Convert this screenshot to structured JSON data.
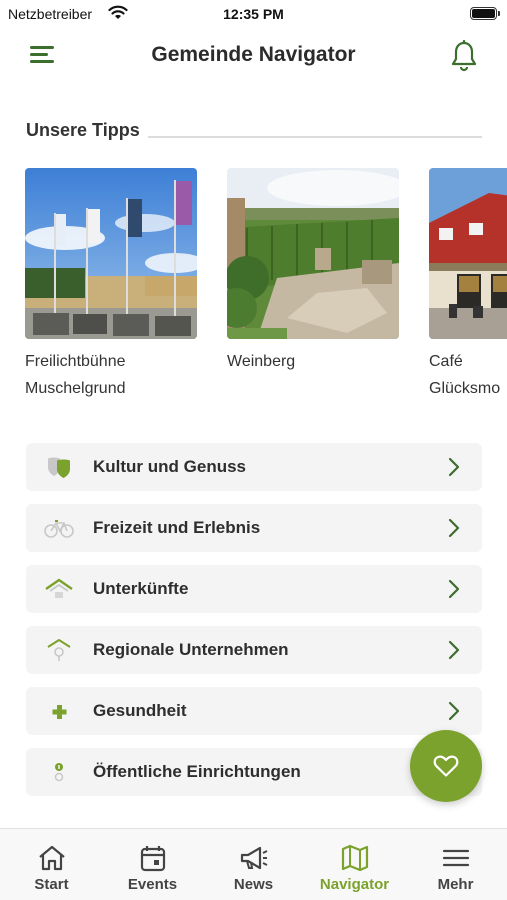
{
  "status_bar": {
    "carrier": "Netzbetreiber",
    "time": "12:35 PM"
  },
  "header": {
    "title": "Gemeinde Navigator"
  },
  "tips_section": {
    "title": "Unsere Tipps",
    "items": [
      {
        "line1": "Freilichtbühne",
        "line2": "Muschelgrund"
      },
      {
        "line1": "Weinberg",
        "line2": ""
      },
      {
        "line1": "Café",
        "line2": "Glücksmo"
      }
    ]
  },
  "categories": [
    {
      "label": "Kultur und Genuss",
      "icon": "theater-masks-icon"
    },
    {
      "label": "Freizeit und Erlebnis",
      "icon": "bicycle-icon"
    },
    {
      "label": "Unterkünfte",
      "icon": "roof-icon"
    },
    {
      "label": "Regionale Unternehmen",
      "icon": "location-pin-house-icon"
    },
    {
      "label": "Gesundheit",
      "icon": "medical-cross-icon"
    },
    {
      "label": "Öffentliche Einrichtungen",
      "icon": "info-pin-icon"
    }
  ],
  "tabbar": {
    "items": [
      {
        "label": "Start",
        "icon": "home-icon",
        "active": false
      },
      {
        "label": "Events",
        "icon": "calendar-icon",
        "active": false
      },
      {
        "label": "News",
        "icon": "megaphone-icon",
        "active": false
      },
      {
        "label": "Navigator",
        "icon": "map-icon",
        "active": true
      },
      {
        "label": "Mehr",
        "icon": "menu-lines-icon",
        "active": false
      }
    ]
  },
  "colors": {
    "brand_green": "#7ba22c",
    "dark_green": "#3c6e2e",
    "card_bg": "#f4f4f4"
  }
}
